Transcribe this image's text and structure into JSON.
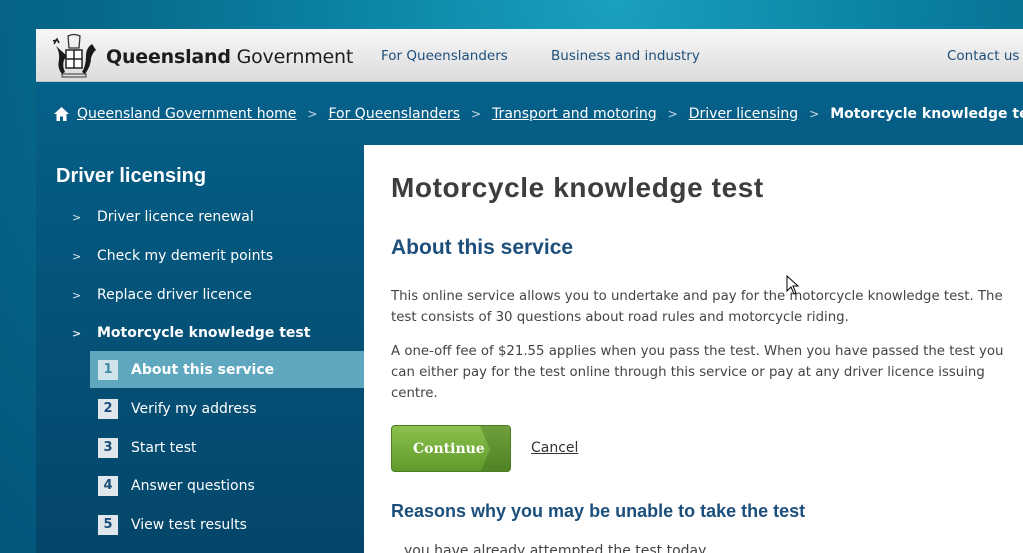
{
  "header": {
    "logo_text_bold": "Queensland",
    "logo_text_regular": "Government",
    "logo_icon": "coat-of-arms-icon",
    "nav": [
      {
        "label": "For Queenslanders"
      },
      {
        "label": "Business and industry"
      }
    ],
    "contact_label": "Contact us"
  },
  "breadcrumb": {
    "home_icon": "home-icon",
    "items": [
      {
        "label": "Queensland Government home"
      },
      {
        "label": "For Queenslanders"
      },
      {
        "label": "Transport and motoring"
      },
      {
        "label": "Driver licensing"
      }
    ],
    "current": "Motorcycle knowledge test",
    "separator": ">"
  },
  "sidebar": {
    "title": "Driver licensing",
    "chevron": ">",
    "items": [
      {
        "label": "Driver licence renewal"
      },
      {
        "label": "Check my demerit points"
      },
      {
        "label": "Replace driver licence"
      },
      {
        "label": "Motorcycle knowledge test",
        "active": true
      }
    ],
    "steps": [
      {
        "num": "1",
        "label": "About this service",
        "current": true
      },
      {
        "num": "2",
        "label": "Verify my address"
      },
      {
        "num": "3",
        "label": "Start test"
      },
      {
        "num": "4",
        "label": "Answer questions"
      },
      {
        "num": "5",
        "label": "View test results"
      }
    ]
  },
  "content": {
    "page_title": "Motorcycle knowledge test",
    "section1_title": "About this service",
    "para1": "This online service allows you to undertake and pay for the motorcycle knowledge test. The test consists of 30 questions about road rules and motorcycle riding.",
    "para2": "A one-off fee of $21.55 applies when you pass the test. When you have passed the test you can either pay for the test online through this service or pay at any driver licence issuing centre.",
    "continue_label": "Continue",
    "cancel_label": "Cancel",
    "section2_title": "Reasons why you may be unable to take the test",
    "clipped_text": "you have already attempted the test today"
  },
  "colors": {
    "brand_blue": "#1c4f7c",
    "band_blue": "#05577e",
    "step_highlight": "#5ea7bf",
    "continue_green": "#6fa835"
  }
}
